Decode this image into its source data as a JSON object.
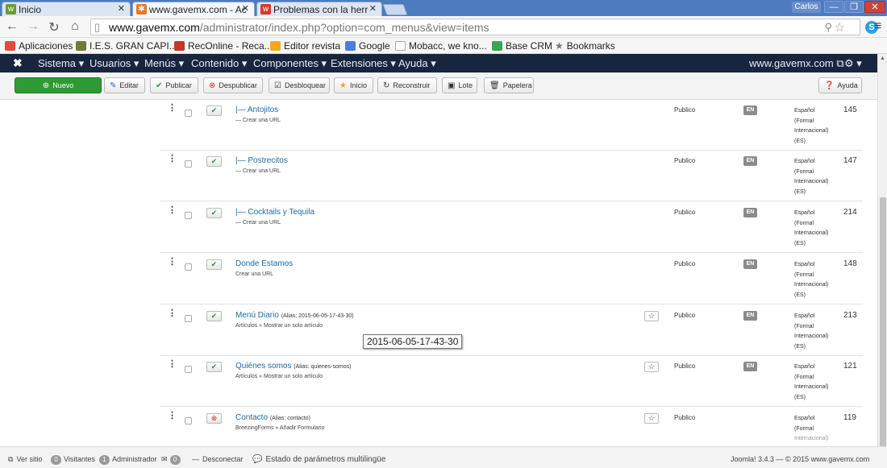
{
  "browser": {
    "tabs": [
      {
        "label": "Inicio",
        "icon": "inicio-favicon"
      },
      {
        "label": "www.gavemx.com - Ac",
        "icon": "joomla-favicon"
      },
      {
        "label": "Problemas con la herr",
        "icon": "w-favicon"
      }
    ],
    "user": "Carlos",
    "url_host": "www.gavemx.com",
    "url_rest": "/administrator/index.php?option=com_menus&view=items"
  },
  "bookmarks": [
    {
      "label": "Aplicaciones",
      "color": "#e24b3b"
    },
    {
      "label": "I.E.S. GRAN CAPI...",
      "color": "#6d7c3a"
    },
    {
      "label": "RecOnline - Reca...",
      "color": "#c0392b"
    },
    {
      "label": "Editor revista",
      "color": "#f5a623"
    },
    {
      "label": "Google",
      "color": "#4a7fdd"
    },
    {
      "label": "Mobacc, we kno...",
      "color": "#cccccc"
    },
    {
      "label": "Base CRM",
      "color": "#3aa655"
    },
    {
      "label": "Bookmarks",
      "color": "#777777"
    }
  ],
  "joomla_nav": {
    "items": [
      "Sistema ▾",
      "Usuarios ▾",
      "Menús ▾",
      "Contenido ▾",
      "Componentes ▾",
      "Extensiones ▾",
      "Ayuda ▾"
    ],
    "site": "www.gavemx.com ⧉",
    "settings": "⚙ ▾"
  },
  "toolbar": {
    "nuevo": "Nuevo",
    "editar": "Editar",
    "publicar": "Publicar",
    "despublicar": "Despublicar",
    "desbloquear": "Desbloquear",
    "inicio": "Inicio",
    "reconstruir": "Reconstruir",
    "lote": "Lote",
    "papelera": "Papelera",
    "ayuda": "Ayuda"
  },
  "rows": [
    {
      "title": "|— Antojitos",
      "alias": "",
      "sub": "— Crear una URL",
      "status": "published",
      "home": false,
      "access": "Publico",
      "lang_badge": "EN",
      "lang_lines": [
        "Español",
        "(Formal",
        "Internacional)",
        "(ES)"
      ],
      "id": "145"
    },
    {
      "title": "|— Postrecitos",
      "alias": "",
      "sub": "— Crear una URL",
      "status": "published",
      "home": false,
      "access": "Publico",
      "lang_badge": "EN",
      "lang_lines": [
        "Español",
        "(Formal",
        "Internacional)",
        "(ES)"
      ],
      "id": "147"
    },
    {
      "title": "|— Cocktails y Tequila",
      "alias": "",
      "sub": "— Crear una URL",
      "status": "published",
      "home": false,
      "access": "Publico",
      "lang_badge": "EN",
      "lang_lines": [
        "Español",
        "(Formal",
        "Internacional)",
        "(ES)"
      ],
      "id": "214"
    },
    {
      "title": "Donde Estamos",
      "alias": "",
      "sub": "Crear una URL",
      "status": "published",
      "home": false,
      "access": "Publico",
      "lang_badge": "EN",
      "lang_lines": [
        "Español",
        "(Formal",
        "Internacional)",
        "(ES)"
      ],
      "id": "148"
    },
    {
      "title": "Menú Diario",
      "alias": "(Alias: 2015-06-05-17-43-30)",
      "sub": "Artículos » Mostrar un solo artículo",
      "status": "published",
      "home": true,
      "access": "Publico",
      "lang_badge": "EN",
      "lang_lines": [
        "Español",
        "(Formal",
        "Internacional)",
        "(ES)"
      ],
      "id": "213"
    },
    {
      "title": "Quiénes somos",
      "alias": "(Alias: quienes-somos)",
      "sub": "Artículos » Mostrar un solo artículo",
      "status": "published",
      "home": true,
      "access": "Publico",
      "lang_badge": "EN",
      "lang_lines": [
        "Español",
        "(Formal",
        "Internacional)",
        "(ES)"
      ],
      "id": "121"
    },
    {
      "title": "Contacto",
      "alias": "(Alias: contacto)",
      "sub": "BreezingForms » Añadir Formulario",
      "status": "unpublished",
      "home": true,
      "access": "Publico",
      "lang_badge": "",
      "lang_lines": [
        "Español",
        "(Formal",
        "Internacional)",
        ""
      ],
      "id": "119"
    }
  ],
  "tooltip": "2015-06-05-17-43-30",
  "statusbar": {
    "ver_sitio": "Ver sitio",
    "visitantes_count": "0",
    "visitantes": "Visitantes",
    "admin_count": "1",
    "administrador": "Administrador",
    "mail_count": "0",
    "desconectar": "Desconectar",
    "multilingue": "Estado de parámetros multilingüe",
    "footer": "Joomla! 3.4.3 — © 2015 www.gavemx.com"
  }
}
